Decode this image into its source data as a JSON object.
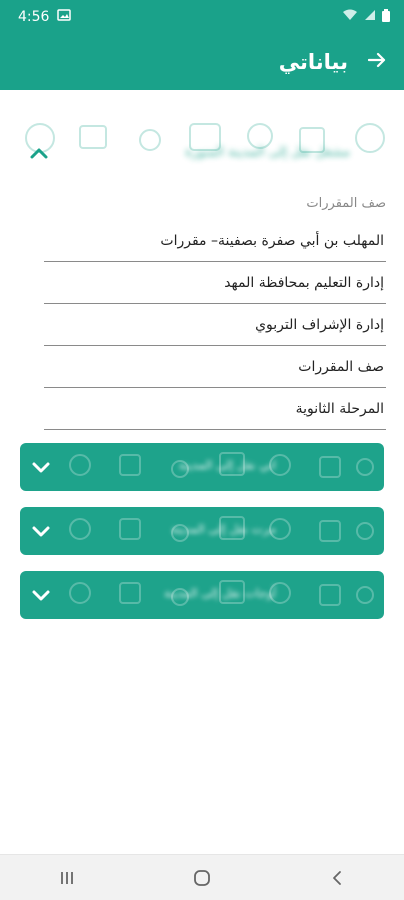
{
  "status_bar": {
    "time": "4:56"
  },
  "header": {
    "title": "بياناتي"
  },
  "section": {
    "blurred_title": "مشغل نقل إلى المدينة المنورة",
    "field_label": "صف المقررات",
    "fields": [
      "المهلب بن أبي صفرة  بصفينة– مقررات",
      "إدارة التعليم بمحافظة المهد",
      "إدارة الإشراف التربوي",
      "صف المقررات",
      "المرحلة الثانوية"
    ]
  },
  "cards": [
    {
      "title": "اتي نقل إلى المدينة"
    },
    {
      "title": "مرت نقل إلى المدينة"
    },
    {
      "title": "أوجات نقل إلى المدينة"
    }
  ],
  "colors": {
    "primary": "#1aa28a",
    "card": "#1ea38b"
  },
  "icons": {
    "back": "arrow-right-icon",
    "collapse": "chevron-up-icon",
    "expand": "chevron-down-icon"
  }
}
